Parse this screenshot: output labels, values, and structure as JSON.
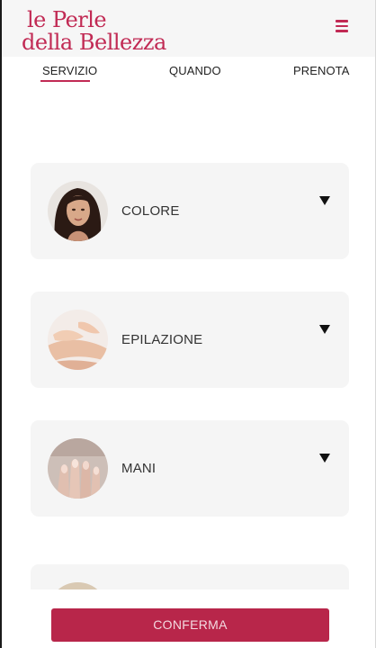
{
  "brand": {
    "line1": "le Perle",
    "line2": "della Bellezza",
    "color": "#c12a54"
  },
  "header": {
    "menu_icon": "hamburger-icon"
  },
  "steps": [
    {
      "label": "SERVIZIO",
      "active": true
    },
    {
      "label": "QUANDO",
      "active": false
    },
    {
      "label": "PRENOTA",
      "active": false
    }
  ],
  "services": [
    {
      "label": "COLORE",
      "icon": "chevron-down-icon"
    },
    {
      "label": "EPILAZIONE",
      "icon": "chevron-down-icon"
    },
    {
      "label": "MANI",
      "icon": "chevron-down-icon"
    },
    {
      "label": "",
      "icon": ""
    }
  ],
  "footer": {
    "confirm_label": "CONFERMA",
    "accent": "#b8264a"
  }
}
